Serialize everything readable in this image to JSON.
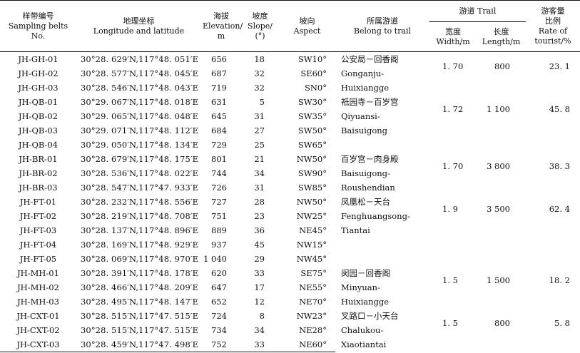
{
  "headers": {
    "belt_zh": "样带编号",
    "belt_en": "Sampling belts No.",
    "coord_zh": "地理坐标",
    "coord_en": "Longitude and latitude",
    "elev_zh": "海拔",
    "elev_en1": "Elevation/",
    "elev_en2": "m",
    "slope_zh": "坡度",
    "slope_en1": "Slope/",
    "slope_en2": "(°)",
    "aspect_zh": "坡向",
    "aspect_en": "Aspect",
    "trail_belong_zh": "所属游道",
    "trail_belong_en": "Belong to trail",
    "trail_group": "游道 Trail",
    "width_zh": "宽度",
    "width_en": "Width/m",
    "length_zh": "长度",
    "length_en": "Length/m",
    "rate_zh1": "游客量",
    "rate_zh2": "比例",
    "rate_en1": "Rate of",
    "rate_en2": "tourist/%"
  },
  "rows": [
    {
      "id": "JH-GH-01",
      "coord": "30°28. 629′N,117°48. 051′E",
      "elev": "656",
      "slope": "18",
      "aspect": "SW10°"
    },
    {
      "id": "JH-GH-02",
      "coord": "30°28. 577′N,117°48. 045′E",
      "elev": "687",
      "slope": "32",
      "aspect": "SE60°"
    },
    {
      "id": "JH-GH-03",
      "coord": "30°28. 546′N,117°48. 043′E",
      "elev": "719",
      "slope": "32",
      "aspect": "SN0°"
    },
    {
      "id": "JH-QB-01",
      "coord": "30°29. 067′N,117°48. 018′E",
      "elev": "631",
      "slope": "5",
      "aspect": "SW30°"
    },
    {
      "id": "JH-QB-02",
      "coord": "30°29. 065′N,117°48. 048′E",
      "elev": "645",
      "slope": "31",
      "aspect": "SW35°"
    },
    {
      "id": "JH-QB-03",
      "coord": "30°29. 071′N,117°48. 112′E",
      "elev": "684",
      "slope": "27",
      "aspect": "SW50°"
    },
    {
      "id": "JH-QB-04",
      "coord": "30°29. 050′N,117°48. 134′E",
      "elev": "729",
      "slope": "25",
      "aspect": "SW65°"
    },
    {
      "id": "JH-BR-01",
      "coord": "30°28. 679′N,117°48. 175′E",
      "elev": "801",
      "slope": "21",
      "aspect": "NW50°"
    },
    {
      "id": "JH-BR-02",
      "coord": "30°28. 536′N,117°48. 022′E",
      "elev": "744",
      "slope": "34",
      "aspect": "SW90°"
    },
    {
      "id": "JH-BR-03",
      "coord": "30°28. 547′N,117°47. 933′E",
      "elev": "726",
      "slope": "31",
      "aspect": "SW85°"
    },
    {
      "id": "JH-FT-01",
      "coord": "30°28. 232′N,117°48. 556′E",
      "elev": "727",
      "slope": "28",
      "aspect": "NW50°"
    },
    {
      "id": "JH-FT-02",
      "coord": "30°28. 219′N,117°48. 708′E",
      "elev": "751",
      "slope": "23",
      "aspect": "NW25°"
    },
    {
      "id": "JH-FT-03",
      "coord": "30°28. 137′N,117°48. 896′E",
      "elev": "889",
      "slope": "36",
      "aspect": "NE45°"
    },
    {
      "id": "JH-FT-04",
      "coord": "30°28. 169′N,117°48. 929′E",
      "elev": "937",
      "slope": "45",
      "aspect": "NW15°"
    },
    {
      "id": "JH-FT-05",
      "coord": "30°28. 069′N,117°48. 970′E",
      "elev": "1 040",
      "slope": "29",
      "aspect": "NW45°"
    },
    {
      "id": "JH-MH-01",
      "coord": "30°28. 391′N,117°48. 178′E",
      "elev": "620",
      "slope": "33",
      "aspect": "SE75°"
    },
    {
      "id": "JH-MH-02",
      "coord": "30°28. 466′N,117°48. 209′E",
      "elev": "647",
      "slope": "17",
      "aspect": "NE55°"
    },
    {
      "id": "JH-MH-03",
      "coord": "30°28. 495′N,117°48. 147′E",
      "elev": "652",
      "slope": "12",
      "aspect": "NE70°"
    },
    {
      "id": "JH-CXT-01",
      "coord": "30°28. 515′N,117°47. 515′E",
      "elev": "724",
      "slope": "8",
      "aspect": "NW23°"
    },
    {
      "id": "JH-CXT-02",
      "coord": "30°28. 515′N,117°47. 515′E",
      "elev": "734",
      "slope": "34",
      "aspect": "NE28°"
    },
    {
      "id": "JH-CXT-03",
      "coord": "30°28. 459′N,117°47. 498′E",
      "elev": "752",
      "slope": "33",
      "aspect": "NE60°"
    }
  ],
  "groups": [
    {
      "zh": "公安局－回香阁",
      "en1": "Gonganju-",
      "en2": "Huixiangge",
      "width": "1. 70",
      "length": "800",
      "rate": "23. 1"
    },
    {
      "zh": "祇园寺－百岁宫",
      "en1": "Qiyuansi-",
      "en2": "Baisuigong",
      "width": "1. 72",
      "length": "1 100",
      "rate": "45. 8"
    },
    {
      "zh": "百岁宫－肉身殿",
      "en1": "Baisuigong-",
      "en2": "Roushendian",
      "width": "1. 70",
      "length": "3 800",
      "rate": "38. 3"
    },
    {
      "zh": "凤凰松－天台",
      "en1": "Fenghuangsong-",
      "en2": "Tiantai",
      "width": "1. 9",
      "length": "3 500",
      "rate": "62. 4"
    },
    {
      "zh": "闵园－回香阁",
      "en1": "Minyuan-",
      "en2": "Huixiangge",
      "width": "1. 5",
      "length": "1 500",
      "rate": "18. 2"
    },
    {
      "zh": "叉路口－小天台",
      "en1": "Chalukou-",
      "en2": "Xiaotiantai",
      "width": "1. 5",
      "length": "800",
      "rate": "5. 8"
    }
  ]
}
